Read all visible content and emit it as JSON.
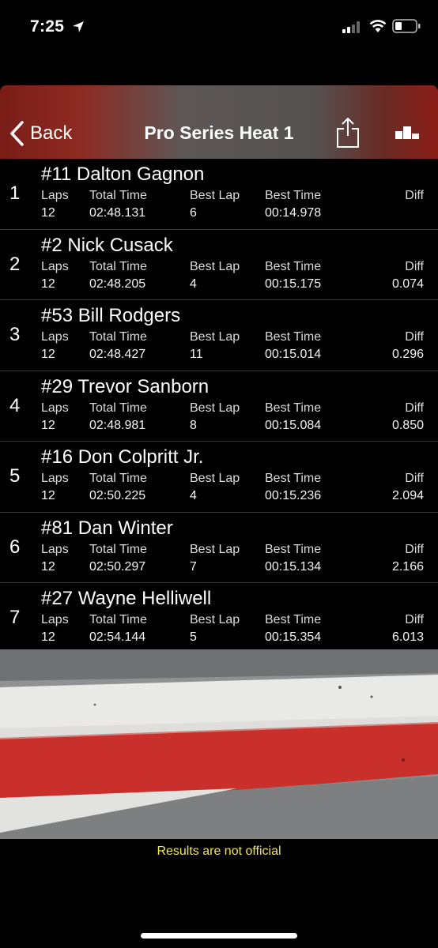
{
  "status_bar": {
    "time": "7:25"
  },
  "nav": {
    "back_label": "Back",
    "title": "Pro Series Heat 1"
  },
  "columns": {
    "laps": "Laps",
    "total_time": "Total Time",
    "best_lap": "Best Lap",
    "best_time": "Best Time",
    "diff": "Diff"
  },
  "results": [
    {
      "position": "1",
      "driver": "#11 Dalton Gagnon",
      "laps": "12",
      "total_time": "02:48.131",
      "best_lap": "6",
      "best_time": "00:14.978",
      "diff": ""
    },
    {
      "position": "2",
      "driver": "#2 Nick Cusack",
      "laps": "12",
      "total_time": "02:48.205",
      "best_lap": "4",
      "best_time": "00:15.175",
      "diff": "0.074"
    },
    {
      "position": "3",
      "driver": "#53 Bill Rodgers",
      "laps": "12",
      "total_time": "02:48.427",
      "best_lap": "11",
      "best_time": "00:15.014",
      "diff": "0.296"
    },
    {
      "position": "4",
      "driver": "#29 Trevor Sanborn",
      "laps": "12",
      "total_time": "02:48.981",
      "best_lap": "8",
      "best_time": "00:15.084",
      "diff": "0.850"
    },
    {
      "position": "5",
      "driver": "#16 Don Colpritt Jr.",
      "laps": "12",
      "total_time": "02:50.225",
      "best_lap": "4",
      "best_time": "00:15.236",
      "diff": "2.094"
    },
    {
      "position": "6",
      "driver": "#81 Dan Winter",
      "laps": "12",
      "total_time": "02:50.297",
      "best_lap": "7",
      "best_time": "00:15.134",
      "diff": "2.166"
    },
    {
      "position": "7",
      "driver": "#27 Wayne Helliwell",
      "laps": "12",
      "total_time": "02:54.144",
      "best_lap": "5",
      "best_time": "00:15.354",
      "diff": "6.013"
    }
  ],
  "footer": {
    "note": "Results are not official"
  },
  "colors": {
    "nav_accent": "#8a1d17",
    "footer_text": "#f5e44a",
    "curb_red": "#c9302c"
  },
  "icons": {
    "back": "chevron-left-icon",
    "share": "share-icon",
    "podium": "podium-icon"
  }
}
